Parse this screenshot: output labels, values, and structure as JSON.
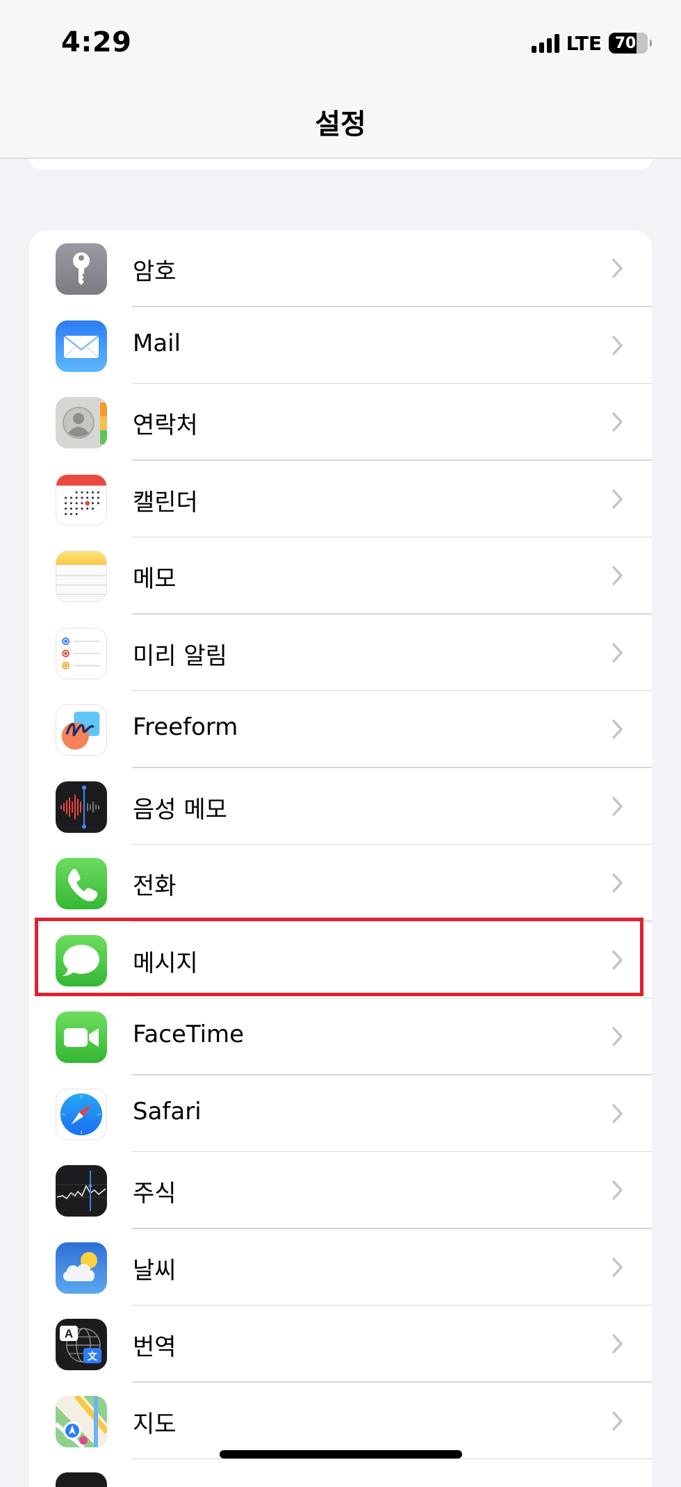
{
  "status_bar": {
    "time": "4:29",
    "network": "LTE",
    "battery": "70"
  },
  "nav": {
    "title": "설정"
  },
  "settings": {
    "items": [
      {
        "label": "암호",
        "icon": "key-icon"
      },
      {
        "label": "Mail",
        "icon": "mail-icon"
      },
      {
        "label": "연락처",
        "icon": "contacts-icon"
      },
      {
        "label": "캘린더",
        "icon": "calendar-icon"
      },
      {
        "label": "메모",
        "icon": "notes-icon"
      },
      {
        "label": "미리 알림",
        "icon": "reminders-icon"
      },
      {
        "label": "Freeform",
        "icon": "freeform-icon"
      },
      {
        "label": "음성 메모",
        "icon": "voice-memos-icon"
      },
      {
        "label": "전화",
        "icon": "phone-icon"
      },
      {
        "label": "메시지",
        "icon": "messages-icon"
      },
      {
        "label": "FaceTime",
        "icon": "facetime-icon"
      },
      {
        "label": "Safari",
        "icon": "safari-icon"
      },
      {
        "label": "주식",
        "icon": "stocks-icon"
      },
      {
        "label": "날씨",
        "icon": "weather-icon"
      },
      {
        "label": "번역",
        "icon": "translate-icon"
      },
      {
        "label": "지도",
        "icon": "maps-icon"
      }
    ]
  },
  "translate_icon_glyphs": {
    "a": "A",
    "b": "文"
  },
  "colors": {
    "highlight": "#e0212f",
    "background": "#f2f2f7",
    "chevron": "#c4c4c7"
  }
}
